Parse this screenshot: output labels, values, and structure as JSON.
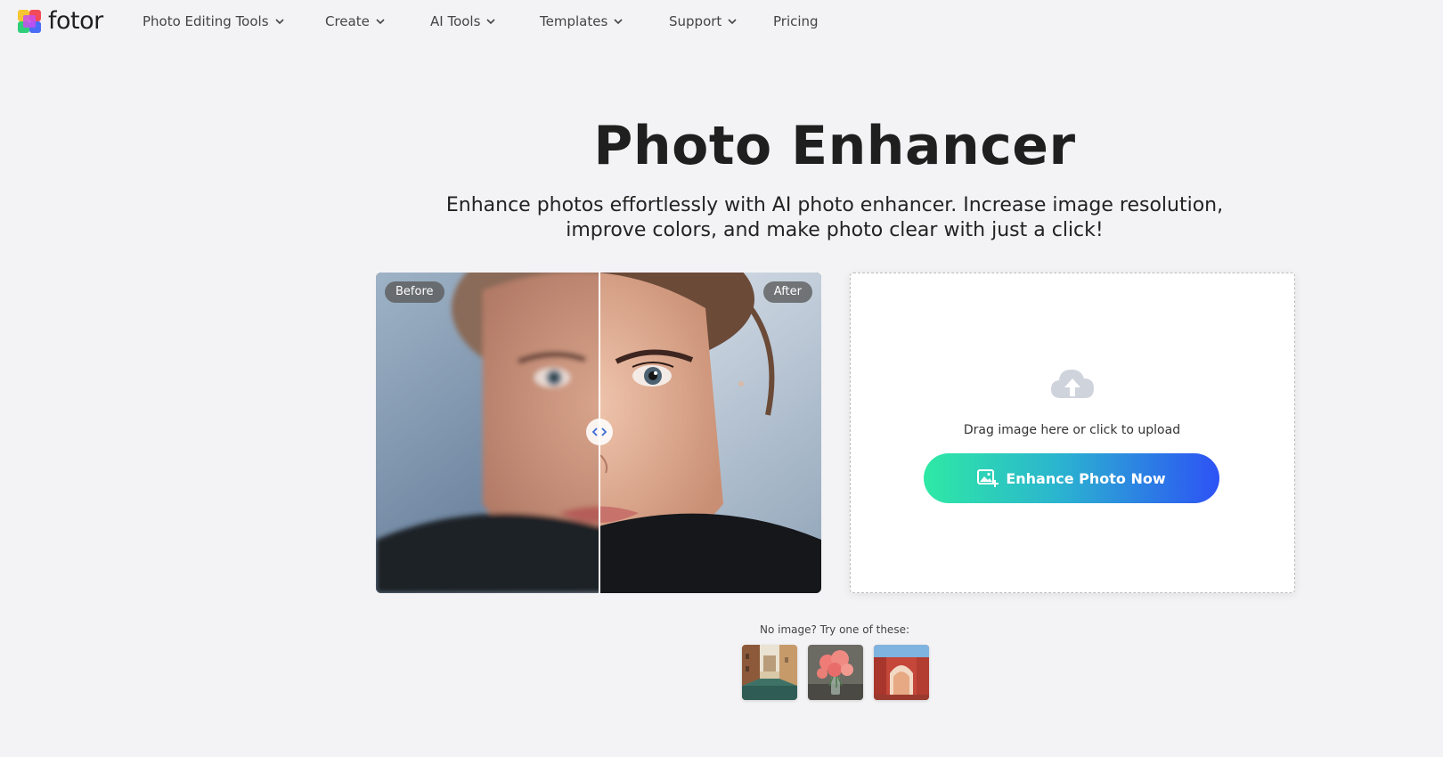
{
  "brand": {
    "name": "fotor"
  },
  "nav": {
    "items": [
      {
        "label": "Photo Editing Tools",
        "has_dropdown": true
      },
      {
        "label": "Create",
        "has_dropdown": true
      },
      {
        "label": "AI Tools",
        "has_dropdown": true
      },
      {
        "label": "Templates",
        "has_dropdown": true
      },
      {
        "label": "Support",
        "has_dropdown": true
      },
      {
        "label": "Pricing",
        "has_dropdown": false
      }
    ]
  },
  "hero": {
    "title": "Photo Enhancer",
    "subtitle_line1": "Enhance photos effortlessly with AI photo enhancer. Increase image resolution,",
    "subtitle_line2": "improve colors, and make photo clear with just a click!"
  },
  "compare": {
    "before_label": "Before",
    "after_label": "After",
    "slider_position": 0.5,
    "handle_icon": "left-right-arrows-icon"
  },
  "upload": {
    "icon": "cloud-upload-icon",
    "drag_text": "Drag image here or click to upload",
    "button_label": "Enhance Photo Now",
    "button_icon": "image-add-icon"
  },
  "samples": {
    "label": "No image? Try one of these:",
    "items": [
      {
        "icon": "venice-canal-thumbnail"
      },
      {
        "icon": "pink-flowers-thumbnail"
      },
      {
        "icon": "red-arch-street-thumbnail"
      }
    ]
  },
  "colors": {
    "background": "#f3f3f5",
    "text": "#1f1f1f",
    "button_gradient_start": "#2ee9a4",
    "button_gradient_end": "#2d52f5"
  }
}
